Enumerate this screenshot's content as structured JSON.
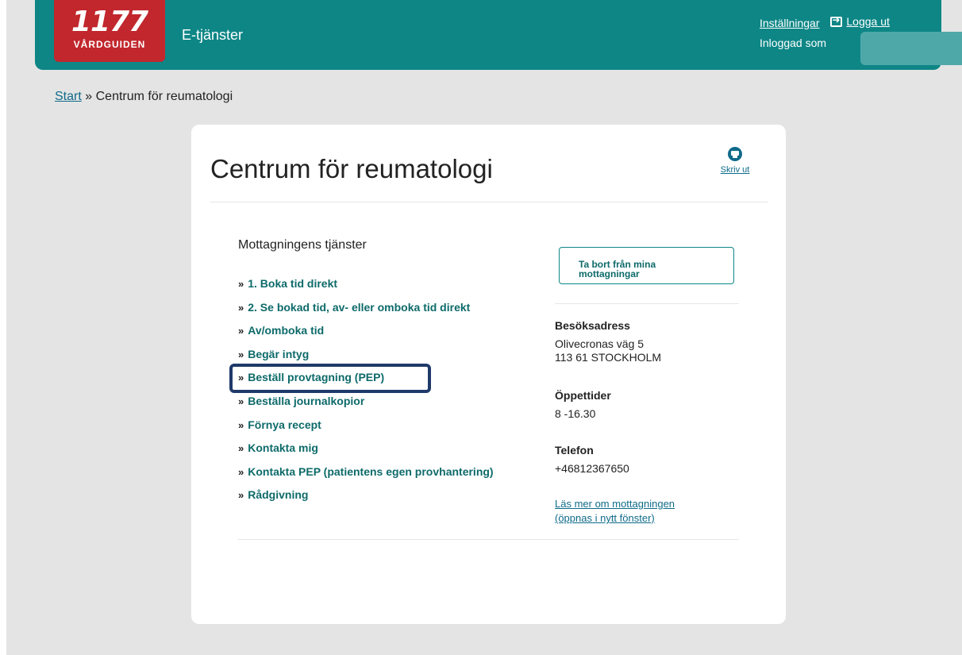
{
  "header": {
    "logo": {
      "number": "1177",
      "subtitle": "VÅRDGUIDEN"
    },
    "app_title": "E-tjänster",
    "settings_label": "Inställningar",
    "logout_label": "Logga ut",
    "logged_in_label": "Inloggad som",
    "brand_color": "#0e8686"
  },
  "breadcrumb": {
    "start_label": "Start",
    "separator": "»",
    "current": "Centrum för reumatologi"
  },
  "page": {
    "title": "Centrum för reumatologi",
    "print_label": "Skriv ut"
  },
  "services": {
    "heading": "Mottagningens tjänster",
    "bullet": "»",
    "items": [
      {
        "label": "1. Boka tid direkt"
      },
      {
        "label": "2. Se bokad tid, av- eller omboka tid direkt"
      },
      {
        "label": "Av/omboka tid"
      },
      {
        "label": "Begär intyg"
      },
      {
        "label": "Beställ provtagning (PEP)",
        "highlighted": true
      },
      {
        "label": "Beställa journalkopior"
      },
      {
        "label": "Förnya recept"
      },
      {
        "label": "Kontakta mig"
      },
      {
        "label": "Kontakta PEP (patientens egen provhantering)"
      },
      {
        "label": "Rådgivning"
      }
    ]
  },
  "sidebar": {
    "remove_button_line1": "Ta bort från mina",
    "remove_button_line2": "mottagningar",
    "address_label": "Besöksadress",
    "address_line1": "Olivecronas väg 5",
    "address_line2": "113 61 STOCKHOLM",
    "hours_label": "Öppettider",
    "hours_value": "8 -16.30",
    "phone_label": "Telefon",
    "phone_value": "+46812367650",
    "more_link_line1": "Läs mer om mottagningen",
    "more_link_line2": "(öppnas i nytt fönster)"
  }
}
